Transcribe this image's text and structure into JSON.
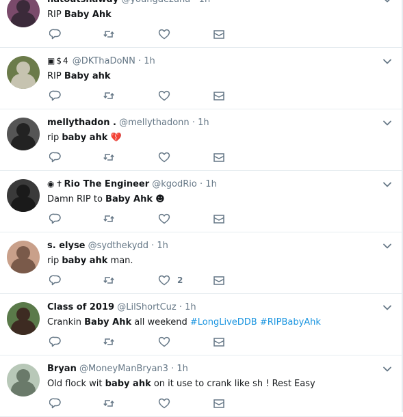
{
  "tweets": [
    {
      "name": "hatoutshawdy",
      "handle": "@youngdezuna",
      "time": "1h",
      "text_pre": "RIP ",
      "text_bold": "Baby Ahk",
      "text_post": "",
      "emoji_after": "",
      "hashtags": "",
      "like_count": "",
      "avatar_colors": [
        "#3b2a3a",
        "#7a4a6b"
      ]
    },
    {
      "name": "",
      "name_emojis": [
        "▣",
        "$",
        "4"
      ],
      "handle": "@DKThaDoNN",
      "time": "1h",
      "text_pre": "RIP ",
      "text_bold": "Baby ahk",
      "text_post": "",
      "emoji_after": "",
      "hashtags": "",
      "like_count": "",
      "avatar_colors": [
        "#c6c3b0",
        "#6b7b4a"
      ]
    },
    {
      "name": "mellythadon .",
      "handle": "@mellythadonn",
      "time": "1h",
      "text_pre": "rip ",
      "text_bold": "baby ahk",
      "text_post": " ",
      "emoji_after": "💔",
      "hashtags": "",
      "like_count": "",
      "avatar_colors": [
        "#222222",
        "#555555"
      ]
    },
    {
      "name": "Rio The Engineer",
      "name_emojis": [
        "◉",
        "✝"
      ],
      "handle": "@kgodRio",
      "time": "1h",
      "text_pre": "Damn RIP to ",
      "text_bold": "Baby Ahk",
      "text_post": " ",
      "emoji_after": "☻",
      "hashtags": "",
      "like_count": "",
      "avatar_colors": [
        "#1a1a1a",
        "#3a3a3a"
      ]
    },
    {
      "name": "s. elyse",
      "handle": "@sydthekydd",
      "time": "1h",
      "text_pre": "rip ",
      "text_bold": "baby ahk",
      "text_post": " man.",
      "emoji_after": "",
      "hashtags": "",
      "like_count": "2",
      "avatar_colors": [
        "#7a5a4a",
        "#c9a08a"
      ]
    },
    {
      "name": "Class of 2019",
      "handle": "@LilShortCuz",
      "time": "1h",
      "text_pre": "Crankin ",
      "text_bold": "Baby Ahk",
      "text_post": " all weekend ",
      "emoji_after": "",
      "hashtags": "#LongLiveDDB #RIPBabyAhk",
      "like_count": "",
      "avatar_colors": [
        "#3d2b22",
        "#5a7a4a"
      ]
    },
    {
      "name": "Bryan",
      "handle": "@MoneyManBryan3",
      "time": "1h",
      "text_pre": "Old flock wit ",
      "text_bold": "baby ahk",
      "text_post": " on it use to crank like sh  ! Rest Easy",
      "emoji_after": "",
      "hashtags": "",
      "like_count": "",
      "avatar_colors": [
        "#6a7a6a",
        "#b8c8b8"
      ]
    }
  ],
  "separator": "·",
  "colors": {
    "name": "#14171a",
    "muted": "#657786",
    "link": "#1b95e0",
    "divider": "#e6ecf0"
  },
  "icons": {
    "reply": "reply-icon",
    "retweet": "retweet-icon",
    "like": "heart-icon",
    "dm": "envelope-icon",
    "menu": "chevron-down-icon"
  }
}
